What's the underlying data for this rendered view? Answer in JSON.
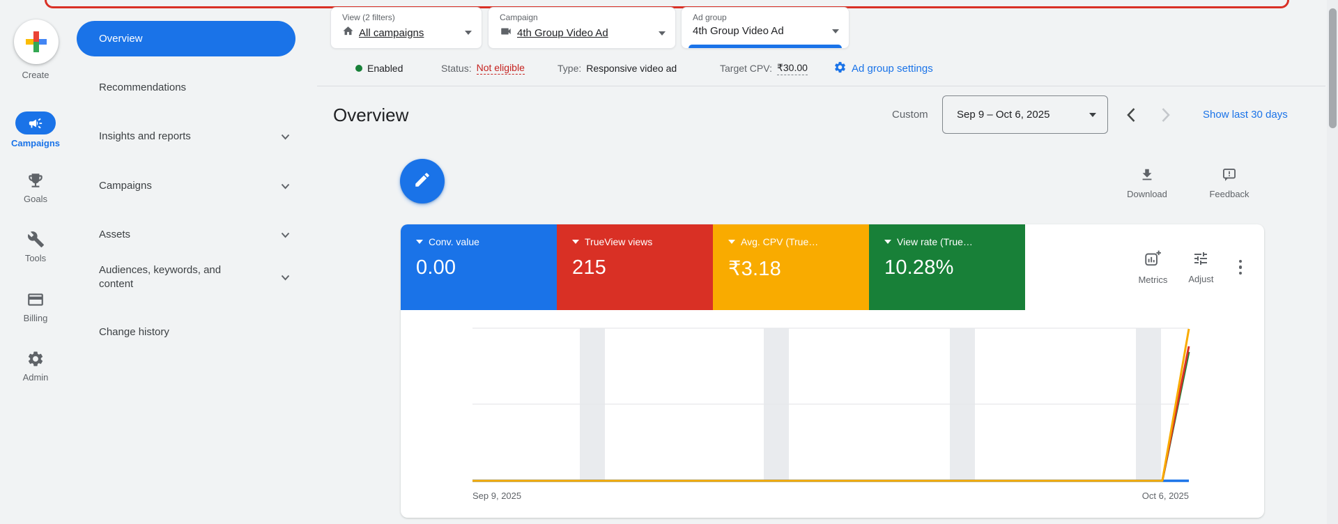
{
  "colors": {
    "blue": "#1a73e8",
    "red": "#d93025",
    "yellow": "#f9ab00",
    "green": "#188038",
    "status_red": "#c5221f"
  },
  "rail": {
    "create": "Create",
    "items": [
      {
        "label": "Campaigns",
        "active": true
      },
      {
        "label": "Goals"
      },
      {
        "label": "Tools"
      },
      {
        "label": "Billing"
      },
      {
        "label": "Admin"
      }
    ]
  },
  "nav": {
    "items": [
      {
        "label": "Overview",
        "active": true
      },
      {
        "label": "Recommendations"
      },
      {
        "label": "Insights and reports",
        "expandable": true
      },
      {
        "label": "Campaigns",
        "expandable": true
      },
      {
        "label": "Assets",
        "expandable": true
      },
      {
        "label": "Audiences, keywords, and content",
        "expandable": true
      },
      {
        "label": "Change history"
      }
    ]
  },
  "context_bar": {
    "chips": [
      {
        "label": "View (2 filters)",
        "value": "All campaigns",
        "icon": "home-icon"
      },
      {
        "label": "Campaign",
        "value": "4th Group Video Ad",
        "icon": "videocam-icon"
      },
      {
        "label": "Ad group",
        "value": "4th Group Video Ad",
        "active": true
      }
    ]
  },
  "status_bar": {
    "enabled": "Enabled",
    "status_label": "Status:",
    "status_value": "Not eligible",
    "type_label": "Type:",
    "type_value": "Responsive video ad",
    "cpv_label": "Target CPV:",
    "cpv_value": "₹30.00",
    "settings": "Ad group settings"
  },
  "header": {
    "title": "Overview",
    "date_mode": "Custom",
    "date_range": "Sep 9 – Oct 6, 2025",
    "show_last": "Show last 30 days",
    "download": "Download",
    "feedback": "Feedback"
  },
  "scorecards": [
    {
      "label": "Conv. value",
      "value": "0.00",
      "color": "#1a73e8"
    },
    {
      "label": "TrueView views",
      "value": "215",
      "color": "#d93025"
    },
    {
      "label": "Avg. CPV (True…",
      "value": "₹3.18",
      "color": "#f9ab00"
    },
    {
      "label": "View rate (True…",
      "value": "10.28%",
      "color": "#188038"
    }
  ],
  "card_actions": {
    "metrics": "Metrics",
    "adjust": "Adjust"
  },
  "chart_data": {
    "type": "line",
    "title": "Ad group overview time series",
    "x_start_label": "Sep 9, 2025",
    "x_end_label": "Oct 6, 2025",
    "x_range": [
      "2025-09-09",
      "2025-10-06"
    ],
    "gridlines": "horizontal",
    "weekend_shading": true,
    "legend_position": "none",
    "series": [
      {
        "name": "Conv. value",
        "color": "#1a73e8",
        "values": [
          0,
          0,
          0,
          0,
          0,
          0,
          0,
          0,
          0,
          0,
          0,
          0,
          0,
          0,
          0,
          0,
          0,
          0,
          0,
          0,
          0,
          0,
          0,
          0,
          0,
          0,
          0,
          0
        ]
      },
      {
        "name": "View rate (TrueView)",
        "color": "#188038",
        "values": [
          0,
          0,
          0,
          0,
          0,
          0,
          0,
          0,
          0,
          0,
          0,
          0,
          0,
          0,
          0,
          0,
          0,
          0,
          0,
          0,
          0,
          0,
          0,
          0,
          0,
          0,
          0,
          10.28
        ]
      },
      {
        "name": "TrueView views",
        "color": "#d93025",
        "values": [
          0,
          0,
          0,
          0,
          0,
          0,
          0,
          0,
          0,
          0,
          0,
          0,
          0,
          0,
          0,
          0,
          0,
          0,
          0,
          0,
          0,
          0,
          0,
          0,
          0,
          0,
          0,
          215
        ]
      },
      {
        "name": "Avg. CPV (TrueView)",
        "color": "#f9ab00",
        "values": [
          0,
          0,
          0,
          0,
          0,
          0,
          0,
          0,
          0,
          0,
          0,
          0,
          0,
          0,
          0,
          0,
          0,
          0,
          0,
          0,
          0,
          0,
          0,
          0,
          0,
          0,
          0,
          3.18
        ]
      }
    ]
  }
}
